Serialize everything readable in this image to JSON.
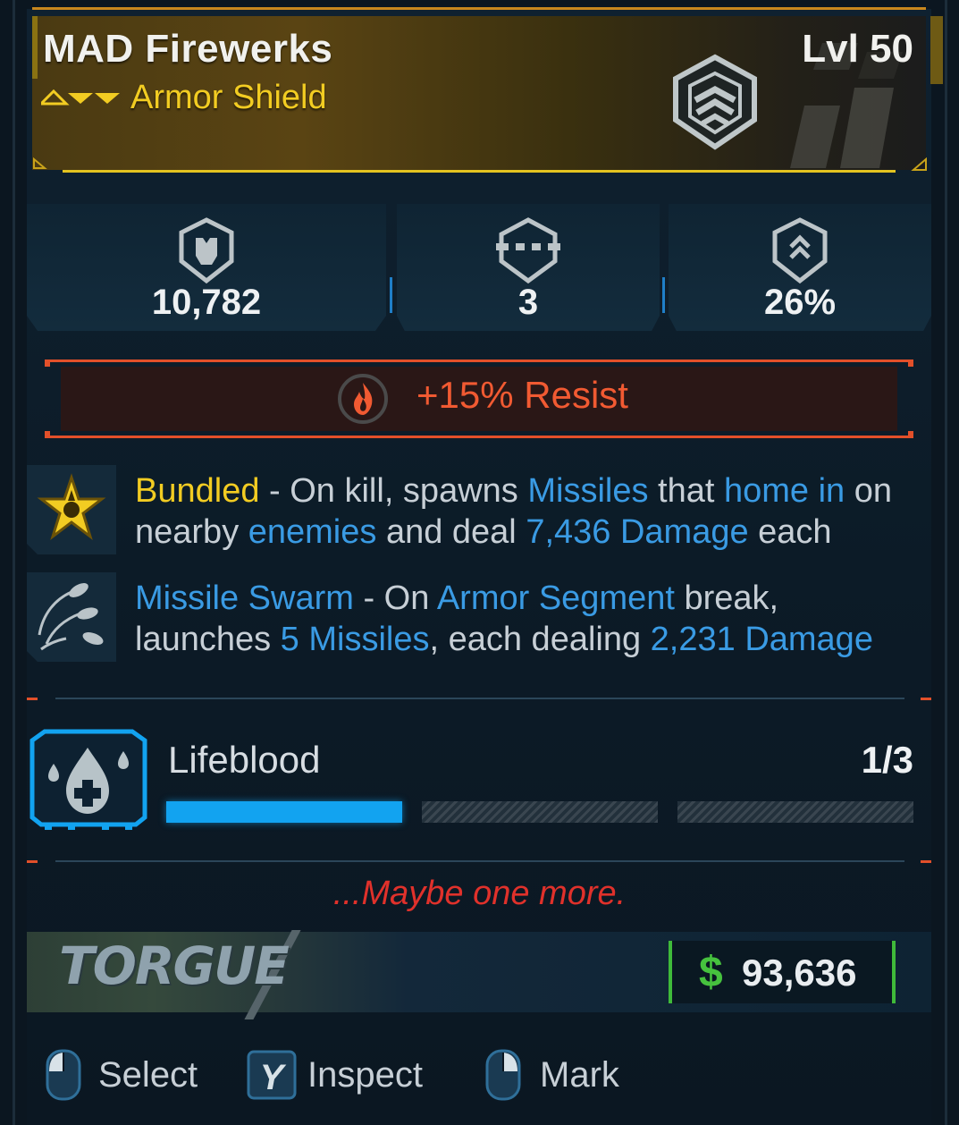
{
  "item": {
    "name": "MAD Firewerks",
    "level": "Lvl 50",
    "type": "Armor Shield",
    "rarity_color": "#f2cc22",
    "rarity_icon": "rarity-chevrons-icon",
    "class_icon": "armor-shield-icon"
  },
  "stats": [
    {
      "icon": "shield-capacity-icon",
      "value": "10,782"
    },
    {
      "icon": "armor-segments-icon",
      "value": "3"
    },
    {
      "icon": "recharge-rate-icon",
      "value": "26%"
    }
  ],
  "resist": {
    "icon": "fire-icon",
    "text": "+15% Resist",
    "color": "#f15a32"
  },
  "perks": [
    {
      "icon": "bundled-star-icon",
      "name": "Bundled",
      "parts": [
        " - On kill, spawns ",
        "Missiles",
        " that ",
        "home in",
        " on nearby ",
        "enemies",
        " and deal ",
        "7,436 Damage",
        " each"
      ]
    },
    {
      "icon": "missile-swarm-icon",
      "name": "Missile Swarm",
      "parts": [
        " - On ",
        "Armor Segment",
        " break, launches ",
        "5 Missiles",
        ", each dealing ",
        "2,231 Damage"
      ]
    }
  ],
  "lifeblood": {
    "icon": "lifeblood-drop-icon",
    "label": "Lifeblood",
    "count": "1/3",
    "filled": 1,
    "total": 3,
    "color": "#12a3f0"
  },
  "flavor": "...Maybe one more.",
  "manufacturer": {
    "logo_text": "TORGUE"
  },
  "price": {
    "currency_icon": "$",
    "value": "93,636",
    "color": "#46c23e"
  },
  "footer": {
    "select": "Select",
    "inspect_key": "Y",
    "inspect": "Inspect",
    "mark": "Mark"
  }
}
